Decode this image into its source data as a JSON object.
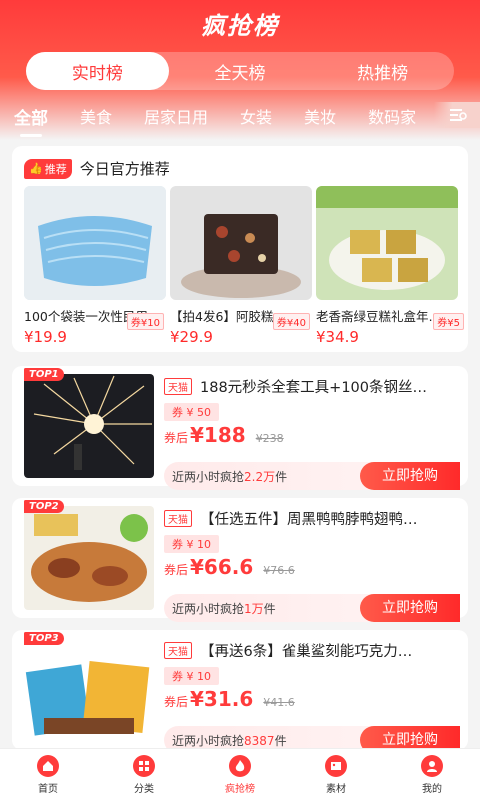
{
  "app_title": "疯抢榜",
  "segments": [
    "实时榜",
    "全天榜",
    "热推榜"
  ],
  "categories": [
    "全部",
    "美食",
    "居家日用",
    "女装",
    "美妆",
    "数码家"
  ],
  "recommend": {
    "badge": "推荐",
    "title": "今日官方推荐",
    "items": [
      {
        "name": "100个袋装一次性民用口罩",
        "price": "¥19.9",
        "coupon": "券¥10"
      },
      {
        "name": "【拍4发6】阿胶糕…",
        "price": "¥29.9",
        "coupon": "券¥40"
      },
      {
        "name": "老香斋绿豆糕礼盒年…",
        "price": "¥34.9",
        "coupon": "券¥5"
      }
    ]
  },
  "rank_items": [
    {
      "rank": "TOP1",
      "store": "天猫",
      "title": "188元秒杀全套工具+100条钢丝…",
      "coupon": "券 ¥ 50",
      "after_label": "券后",
      "price": "¥188",
      "orig": "¥238",
      "sales_prefix": "近两小时疯抢",
      "sales_value": "2.2万",
      "sales_suffix": "件",
      "buy": "立即抢购"
    },
    {
      "rank": "TOP2",
      "store": "天猫",
      "title": "【任选五件】周黑鸭鸭脖鸭翅鸭…",
      "coupon": "券 ¥ 10",
      "after_label": "券后",
      "price": "¥66.6",
      "orig": "¥76.6",
      "sales_prefix": "近两小时疯抢",
      "sales_value": "1万",
      "sales_suffix": "件",
      "buy": "立即抢购"
    },
    {
      "rank": "TOP3",
      "store": "天猫",
      "title": "【再送6条】雀巢鲨刻能巧克力…",
      "coupon": "券 ¥ 10",
      "after_label": "券后",
      "price": "¥31.6",
      "orig": "¥41.6",
      "sales_prefix": "近两小时疯抢",
      "sales_value": "8387",
      "sales_suffix": "件",
      "buy": "立即抢购"
    }
  ],
  "tabbar": [
    {
      "label": "首页",
      "icon": "home-icon"
    },
    {
      "label": "分类",
      "icon": "category-icon"
    },
    {
      "label": "疯抢榜",
      "icon": "fire-icon"
    },
    {
      "label": "素材",
      "icon": "material-icon"
    },
    {
      "label": "我的",
      "icon": "profile-icon"
    }
  ],
  "colors": {
    "accent": "#ff3b3b"
  }
}
